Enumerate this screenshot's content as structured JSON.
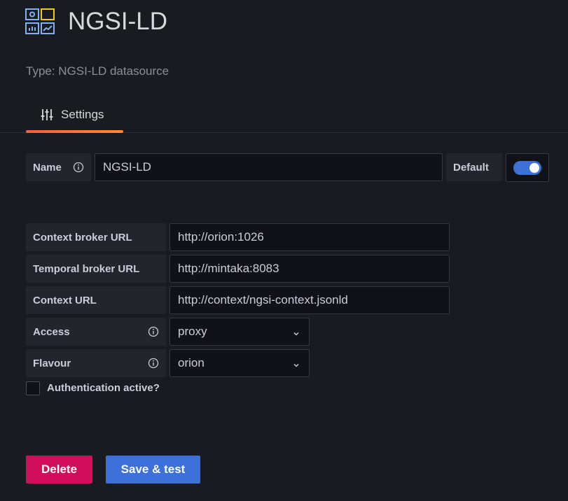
{
  "header": {
    "title": "NGSI-LD",
    "subtitle": "Type: NGSI-LD datasource",
    "logo_icon": "dashboard-grid-icon"
  },
  "tabs": [
    {
      "label": "Settings",
      "icon": "sliders-icon",
      "active": true
    }
  ],
  "name_row": {
    "label": "Name",
    "value": "NGSI-LD",
    "default_label": "Default",
    "default_enabled": true
  },
  "fields": {
    "context_broker_url": {
      "label": "Context broker URL",
      "value": "http://orion:1026"
    },
    "temporal_broker_url": {
      "label": "Temporal broker URL",
      "value": "http://mintaka:8083"
    },
    "context_url": {
      "label": "Context URL",
      "value": "http://context/ngsi-context.jsonld"
    },
    "access": {
      "label": "Access",
      "value": "proxy"
    },
    "flavour": {
      "label": "Flavour",
      "value": "orion"
    }
  },
  "auth": {
    "label": "Authentication active?",
    "checked": false
  },
  "buttons": {
    "delete_label": "Delete",
    "save_label": "Save & test"
  },
  "colors": {
    "background": "#181b1f",
    "accent_blue": "#3d71d9",
    "danger": "#d10e5c",
    "tab_underline": "#f55f3e"
  }
}
